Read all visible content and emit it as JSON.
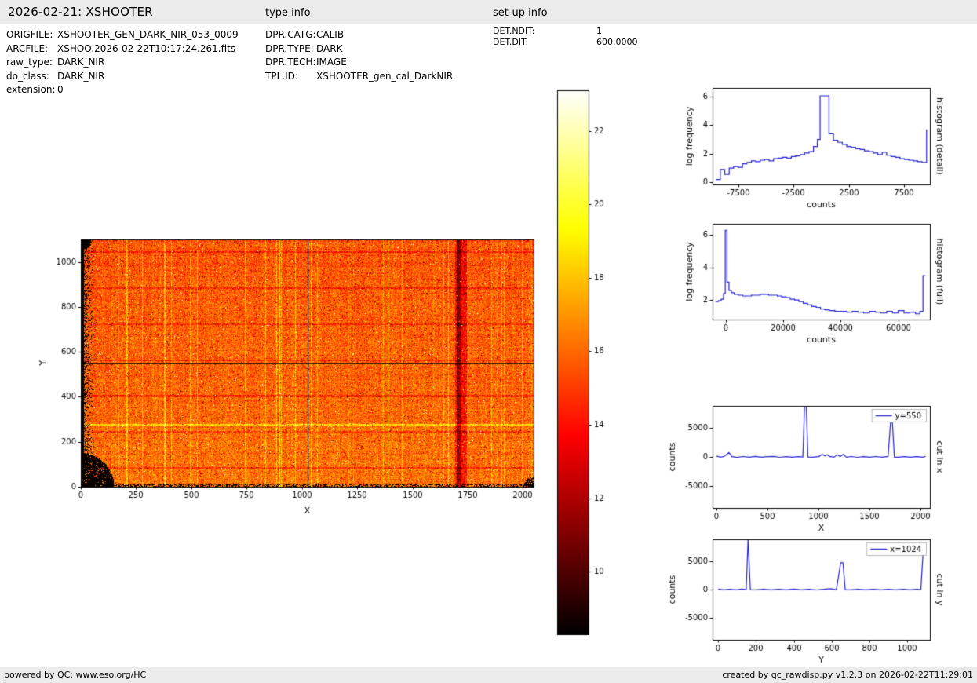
{
  "header": {
    "title": "2026-02-21: XSHOOTER",
    "type_info_label": "type info",
    "setup_info_label": "set-up info"
  },
  "metadata": {
    "left": [
      {
        "key": "ORIGFILE:",
        "value": "XSHOOTER_GEN_DARK_NIR_053_0009"
      },
      {
        "key": "ARCFILE:",
        "value": "XSHOO.2026-02-22T10:17:24.261.fits"
      },
      {
        "key": "raw_type:",
        "value": "DARK_NIR"
      },
      {
        "key": "do_class:",
        "value": "DARK_NIR"
      },
      {
        "key": "extension:",
        "value": "0"
      }
    ],
    "middle": [
      {
        "key": "DPR.CATG:",
        "value": "CALIB"
      },
      {
        "key": "DPR.TYPE:",
        "value": "DARK"
      },
      {
        "key": "DPR.TECH:",
        "value": "IMAGE"
      },
      {
        "key": "TPL.ID:",
        "value": "XSHOOTER_gen_cal_DarkNIR"
      }
    ],
    "setup": [
      {
        "key": "DET.NDIT:",
        "value": "1"
      },
      {
        "key": "DET.DIT:",
        "value": "600.0000"
      }
    ]
  },
  "footer": {
    "left": "powered by QC: www.eso.org/HC",
    "right": "created by qc_rawdisp.py v1.2.3 on 2026-02-22T11:29:01"
  },
  "chart_data": [
    {
      "type": "heatmap",
      "name": "raw dark frame image",
      "xlabel": "X",
      "ylabel": "Y",
      "xlim": [
        0,
        2048
      ],
      "ylim": [
        0,
        1100
      ],
      "xticks": [
        0,
        250,
        500,
        750,
        1000,
        1250,
        1500,
        1750,
        2000
      ],
      "yticks": [
        0,
        200,
        400,
        600,
        800,
        1000
      ],
      "colormap": "hot",
      "value_range": [
        8.3,
        23.1
      ],
      "colorbar_ticks": [
        10,
        12,
        14,
        16,
        18,
        20,
        22
      ],
      "typical_level": 16,
      "features": {
        "cut_line_x": 1024,
        "cut_line_y": 550,
        "dark_column_band_x": [
          1690,
          1745
        ],
        "bright_row_y": 275,
        "dead_edges": "left column and bottom-left corner black"
      }
    },
    {
      "type": "line",
      "step": true,
      "right_label": "histogram (detail)",
      "xlabel": "counts",
      "ylabel": "log frequency",
      "xlim": [
        -9800,
        9800
      ],
      "ylim": [
        -0.15,
        6.6
      ],
      "xticks": [
        -7500,
        -2500,
        2500,
        7500
      ],
      "yticks": [
        0,
        2,
        4,
        6
      ],
      "color": "#2222cc",
      "x": [
        -9500,
        -9100,
        -8700,
        -8300,
        -7900,
        -7500,
        -7100,
        -6700,
        -6300,
        -5900,
        -5500,
        -5100,
        -4700,
        -4300,
        -3900,
        -3500,
        -3100,
        -2700,
        -2300,
        -1900,
        -1500,
        -1100,
        -700,
        -350,
        -100,
        300,
        700,
        1100,
        1500,
        1900,
        2300,
        2700,
        3100,
        3500,
        3900,
        4300,
        4700,
        5100,
        5500,
        5900,
        6300,
        6700,
        7100,
        7500,
        7900,
        8300,
        8700,
        9100,
        9500
      ],
      "y": [
        0.2,
        0.9,
        0.55,
        1.0,
        1.1,
        1.05,
        1.3,
        1.4,
        1.5,
        1.45,
        1.55,
        1.6,
        1.5,
        1.65,
        1.7,
        1.75,
        1.7,
        1.8,
        1.85,
        1.95,
        2.05,
        2.15,
        2.5,
        3.0,
        6.05,
        6.05,
        3.4,
        2.95,
        2.8,
        2.65,
        2.5,
        2.45,
        2.35,
        2.3,
        2.2,
        2.15,
        2.05,
        1.95,
        2.1,
        1.9,
        1.8,
        1.75,
        1.65,
        1.6,
        1.55,
        1.5,
        1.45,
        1.4,
        3.7
      ]
    },
    {
      "type": "line",
      "step": true,
      "right_label": "histogram (full)",
      "xlabel": "counts",
      "ylabel": "log frequency",
      "xlim": [
        -4500,
        71000
      ],
      "ylim": [
        0.8,
        6.7
      ],
      "xticks": [
        0,
        20000,
        40000,
        60000
      ],
      "yticks": [
        2,
        4,
        6
      ],
      "color": "#2222cc",
      "x": [
        -3500,
        -2500,
        -1500,
        -700,
        -100,
        500,
        1200,
        2000,
        3000,
        4500,
        6000,
        7500,
        9000,
        10500,
        12000,
        13500,
        15000,
        16500,
        18000,
        19500,
        21000,
        22500,
        24000,
        25500,
        27000,
        28500,
        30000,
        31500,
        33000,
        34500,
        36000,
        38000,
        40000,
        42000,
        44000,
        46000,
        48000,
        50000,
        52000,
        54000,
        56000,
        58000,
        60000,
        62000,
        64000,
        66000,
        67500,
        68600,
        69400
      ],
      "y": [
        1.9,
        1.95,
        2.05,
        2.4,
        6.3,
        3.1,
        2.6,
        2.45,
        2.35,
        2.3,
        2.25,
        2.25,
        2.3,
        2.3,
        2.35,
        2.35,
        2.3,
        2.3,
        2.25,
        2.2,
        2.15,
        2.05,
        2.0,
        1.9,
        1.8,
        1.7,
        1.6,
        1.55,
        1.45,
        1.4,
        1.35,
        1.3,
        1.3,
        1.25,
        1.3,
        1.25,
        1.2,
        1.3,
        1.25,
        1.2,
        1.3,
        1.2,
        1.35,
        1.2,
        1.25,
        1.15,
        1.3,
        3.5,
        3.5
      ]
    },
    {
      "type": "line",
      "step": false,
      "right_label": "cut in x",
      "legend": "y=550",
      "xlabel": "X",
      "ylabel": "counts",
      "xlim": [
        -40,
        2090
      ],
      "ylim": [
        -8800,
        8800
      ],
      "xticks": [
        0,
        500,
        1000,
        1500,
        2000
      ],
      "yticks": [
        -5000,
        0,
        5000
      ],
      "color": "#2222cc",
      "x": [
        0,
        40,
        80,
        120,
        150,
        200,
        260,
        320,
        380,
        440,
        500,
        560,
        620,
        680,
        740,
        800,
        845,
        862,
        878,
        895,
        940,
        1000,
        1022,
        1038,
        1060,
        1082,
        1105,
        1150,
        1180,
        1212,
        1242,
        1272,
        1320,
        1380,
        1440,
        1500,
        1560,
        1620,
        1680,
        1705,
        1722,
        1742,
        1780,
        1840,
        1900,
        1960,
        2020,
        2048
      ],
      "y": [
        120,
        -60,
        140,
        760,
        40,
        -80,
        70,
        -50,
        90,
        -60,
        50,
        85,
        -70,
        45,
        -55,
        60,
        -20,
        9000,
        9000,
        -30,
        -60,
        55,
        320,
        430,
        160,
        390,
        90,
        -55,
        360,
        70,
        430,
        -45,
        65,
        -70,
        55,
        -45,
        65,
        -55,
        85,
        6000,
        6000,
        -40,
        -60,
        55,
        -45,
        60,
        -50,
        80
      ]
    },
    {
      "type": "line",
      "step": false,
      "right_label": "cut in y",
      "legend": "x=1024",
      "xlabel": "Y",
      "ylabel": "counts",
      "xlim": [
        -30,
        1120
      ],
      "ylim": [
        -8800,
        8800
      ],
      "xticks": [
        0,
        200,
        400,
        600,
        800,
        1000
      ],
      "yticks": [
        -5000,
        0,
        5000
      ],
      "color": "#2222cc",
      "x": [
        0,
        30,
        60,
        95,
        125,
        148,
        158,
        170,
        200,
        240,
        280,
        320,
        360,
        400,
        440,
        480,
        520,
        560,
        595,
        625,
        648,
        660,
        672,
        700,
        740,
        780,
        820,
        860,
        900,
        940,
        980,
        1015,
        1050,
        1072,
        1085,
        1100
      ],
      "y": [
        90,
        -60,
        55,
        -45,
        75,
        -20,
        8800,
        -30,
        -50,
        60,
        -40,
        55,
        -60,
        80,
        -50,
        45,
        -70,
        60,
        160,
        -30,
        4700,
        4700,
        -40,
        -60,
        55,
        -45,
        60,
        -50,
        70,
        -40,
        55,
        -60,
        45,
        -20,
        7000,
        7000
      ]
    }
  ]
}
